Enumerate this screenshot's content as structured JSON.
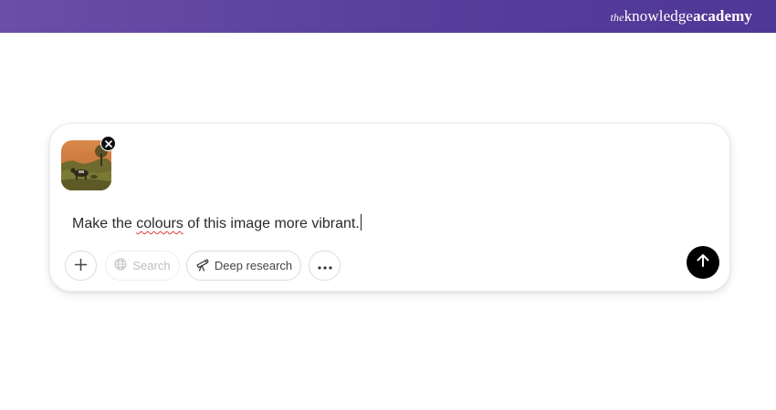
{
  "brand": {
    "prefix": "the",
    "name_regular": "knowledge",
    "name_bold": "academy"
  },
  "composer": {
    "attachment": {
      "type": "image",
      "description_icon": "landscape-thumbnail"
    },
    "prompt_parts": {
      "before": "Make the ",
      "misspelled": "colours",
      "after": " of this image more vibrant."
    },
    "toolbar": {
      "add_icon": "plus-icon",
      "search_label": "Search",
      "search_icon": "globe-icon",
      "deep_research_label": "Deep research",
      "deep_research_icon": "telescope-icon",
      "more_icon": "ellipsis-icon",
      "send_icon": "arrow-up-icon"
    }
  },
  "colors": {
    "header_start": "#6a4ea8",
    "header_end": "#4e3795",
    "send_button": "#000000",
    "spellcheck_underline": "#e03a3a"
  }
}
